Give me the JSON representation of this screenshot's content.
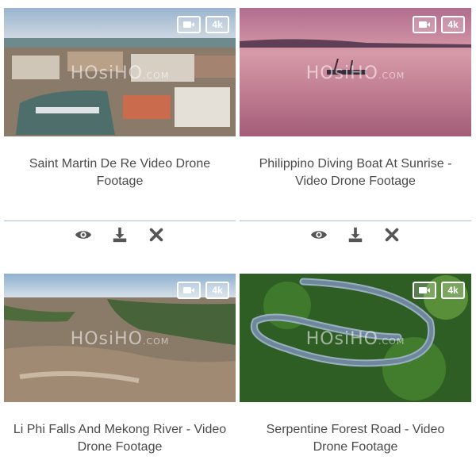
{
  "cards": [
    {
      "title": "Saint Martin De Re Video Drone Footage",
      "watermark_main": "HOsiHO",
      "watermark_sub": ".COM",
      "badge_quality": "4k",
      "actions": [
        "eye-icon",
        "download-icon",
        "close-icon"
      ]
    },
    {
      "title": "Philippino Diving Boat At Sunrise - Video Drone Footage",
      "watermark_main": "HOsiHO",
      "watermark_sub": ".COM",
      "badge_quality": "4k",
      "actions": [
        "eye-icon",
        "download-icon",
        "close-icon"
      ]
    },
    {
      "title": "Li Phi Falls And Mekong River - Video Drone Footage",
      "watermark_main": "HOsiHO",
      "watermark_sub": ".COM",
      "badge_quality": "4k"
    },
    {
      "title": "Serpentine Forest Road - Video Drone Footage",
      "watermark_main": "HOsiHO",
      "watermark_sub": ".COM",
      "badge_quality": "4k"
    }
  ],
  "colors": {
    "divider": "#a9bfd4",
    "icon": "#555555"
  }
}
